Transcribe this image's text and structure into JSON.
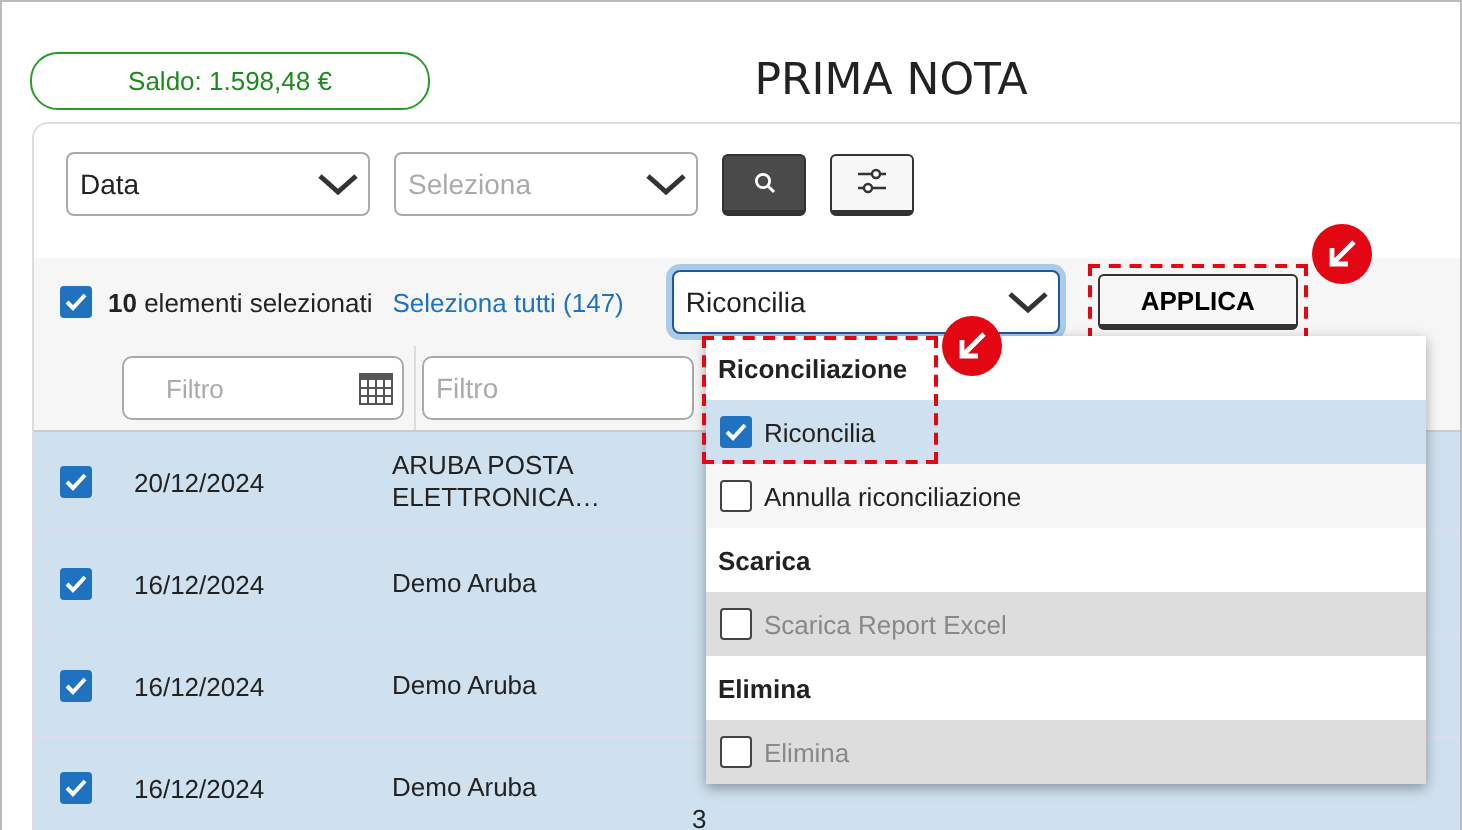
{
  "header": {
    "balance": "Saldo: 1.598,48 €",
    "title": "PRIMA NOTA"
  },
  "filters": [
    {
      "kind": "select",
      "value": "Data"
    },
    {
      "kind": "select",
      "placeholder": "Seleziona"
    }
  ],
  "selection": {
    "checked": true,
    "label": "**10** elementi selezionati",
    "select_all": "Seleziona tutti (147)"
  },
  "action": {
    "value": "Riconcilia",
    "button": "APPLICA",
    "highlighted": true
  },
  "column_filters": [
    {
      "kind": "date",
      "placeholder": "Filtro"
    },
    {
      "kind": "text",
      "placeholder": "Filtro"
    }
  ],
  "rows": [
    {
      "selected": true,
      "date": "20/12/2024",
      "description": "ARUBA POSTA ELETTRONICA…"
    },
    {
      "selected": true,
      "date": "16/12/2024",
      "description": "Demo Aruba"
    },
    {
      "selected": true,
      "date": "16/12/2024",
      "description": "Demo Aruba"
    },
    {
      "selected": true,
      "date": "16/12/2024",
      "description": "Demo Aruba",
      "column_3": "3"
    }
  ],
  "menu": {
    "groups": [
      {
        "title": "Riconciliazione",
        "highlighted": true,
        "items": [
          {
            "label": "Riconcilia",
            "checked": true,
            "selected": true,
            "disabled": false
          },
          {
            "label": "Annulla riconciliazione",
            "checked": false,
            "selected": false,
            "disabled": false
          }
        ]
      },
      {
        "title": "Scarica",
        "highlighted": false,
        "items": [
          {
            "label": "Scarica Report Excel",
            "checked": false,
            "selected": false,
            "disabled": true
          }
        ]
      },
      {
        "title": "Elimina",
        "highlighted": false,
        "items": [
          {
            "label": "Elimina",
            "checked": false,
            "selected": false,
            "disabled": true
          }
        ]
      }
    ]
  }
}
